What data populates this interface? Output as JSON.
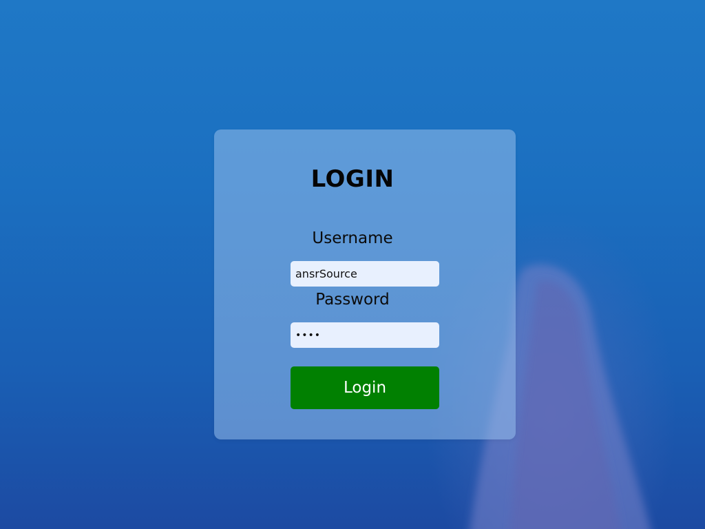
{
  "login": {
    "title": "LOGIN",
    "username_label": "Username",
    "username_value": "ansrSource",
    "password_label": "Password",
    "password_value": "abcd",
    "submit_label": "Login"
  },
  "colors": {
    "button": "#018001",
    "input_bg": "#e8f0fe",
    "background": "#1b6fc0"
  }
}
